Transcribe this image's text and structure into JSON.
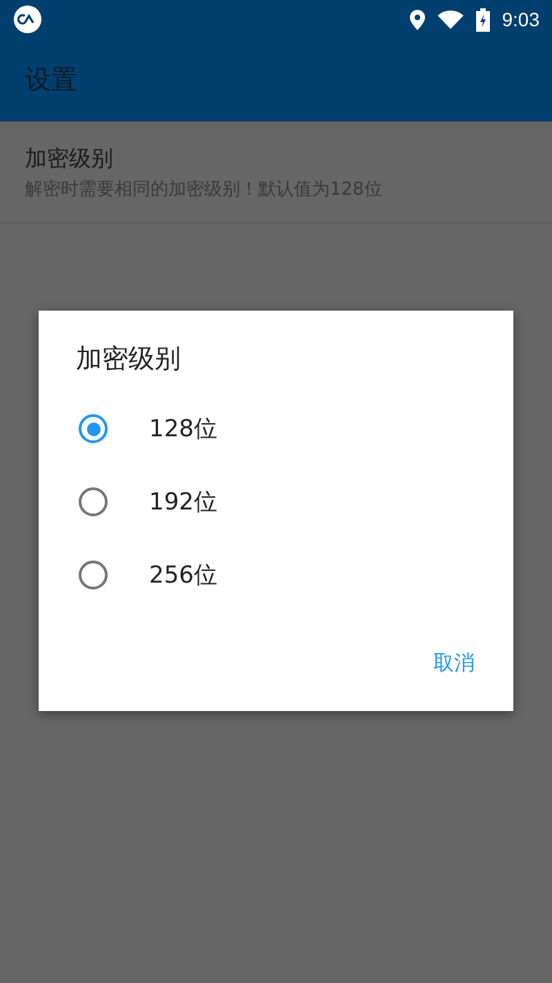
{
  "status_bar": {
    "time": "9:03"
  },
  "toolbar": {
    "title": "设置"
  },
  "preference": {
    "title": "加密级别",
    "summary": "解密时需要相同的加密级别！默认值为128位"
  },
  "dialog": {
    "title": "加密级别",
    "options": [
      {
        "label": "128位",
        "selected": true
      },
      {
        "label": "192位",
        "selected": false
      },
      {
        "label": "256位",
        "selected": false
      }
    ],
    "buttons": [
      "取消"
    ]
  }
}
